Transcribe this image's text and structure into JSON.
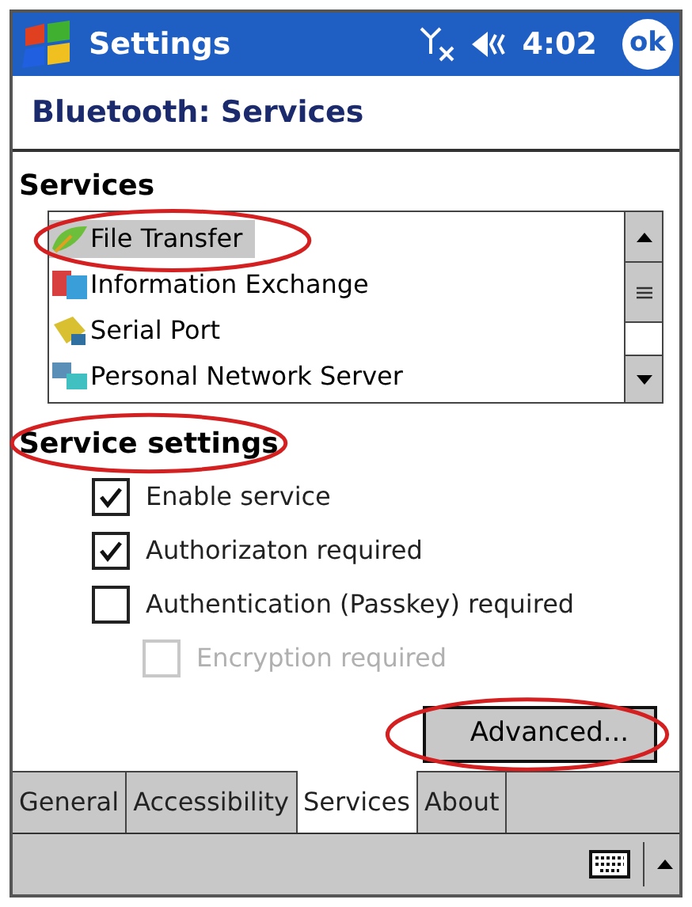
{
  "title_bar": {
    "title": "Settings",
    "time": "4:02",
    "ok": "ok"
  },
  "header": "Bluetooth: Services",
  "services": {
    "label": "Services",
    "items": [
      {
        "label": "File Transfer",
        "kind": "transfer",
        "selected": true,
        "highlighted": true
      },
      {
        "label": "Information Exchange",
        "kind": "exchange",
        "selected": false,
        "highlighted": false
      },
      {
        "label": "Serial Port",
        "kind": "serial",
        "selected": false,
        "highlighted": false
      },
      {
        "label": "Personal Network Server",
        "kind": "network",
        "selected": false,
        "highlighted": false
      }
    ]
  },
  "service_settings": {
    "label": "Service settings",
    "highlighted": true,
    "options": [
      {
        "label": "Enable service",
        "checked": true,
        "disabled": false,
        "indented": false
      },
      {
        "label": "Authorizaton required",
        "checked": true,
        "disabled": false,
        "indented": false
      },
      {
        "label": "Authentication (Passkey) required",
        "checked": false,
        "disabled": false,
        "indented": false
      },
      {
        "label": "Encryption required",
        "checked": false,
        "disabled": true,
        "indented": true
      }
    ]
  },
  "advanced_button": {
    "label": "Advanced...",
    "highlighted": true
  },
  "tabs": [
    {
      "label": "General",
      "selected": false
    },
    {
      "label": "Accessibility",
      "selected": false
    },
    {
      "label": "Services",
      "selected": true
    },
    {
      "label": "About",
      "selected": false
    }
  ]
}
